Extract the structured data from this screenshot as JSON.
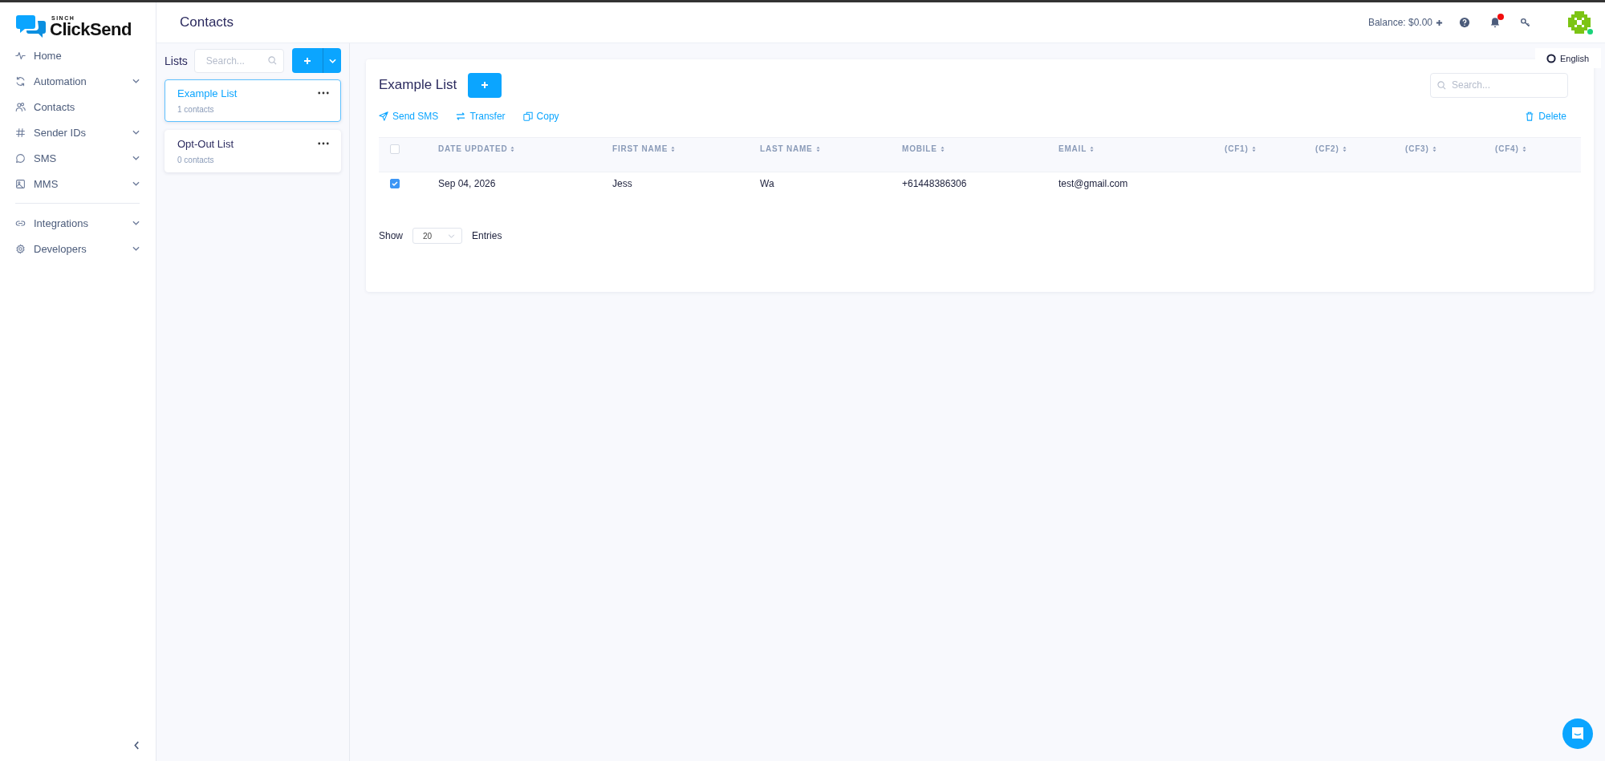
{
  "logo": {
    "brand": "SINCH",
    "name": "ClickSend"
  },
  "sidebar": {
    "groups": [
      [
        {
          "label": "Home",
          "expandable": false
        },
        {
          "label": "Automation",
          "expandable": true
        },
        {
          "label": "Contacts",
          "expandable": false
        },
        {
          "label": "Sender IDs",
          "expandable": true
        },
        {
          "label": "SMS",
          "expandable": true
        },
        {
          "label": "MMS",
          "expandable": true
        }
      ],
      [
        {
          "label": "Integrations",
          "expandable": true
        },
        {
          "label": "Developers",
          "expandable": true
        }
      ]
    ]
  },
  "header": {
    "title": "Contacts",
    "balance": "Balance: $0.00",
    "notifications_unread": true,
    "avatar_online": true
  },
  "language": "English",
  "lists_panel": {
    "title": "Lists",
    "search": {
      "placeholder": "Search..."
    },
    "lists": [
      {
        "name": "Example List",
        "count": "1 contacts",
        "selected": true
      },
      {
        "name": "Opt-Out List",
        "count": "0 contacts",
        "selected": false
      }
    ]
  },
  "main": {
    "title": "Example List",
    "search": {
      "placeholder": "Search..."
    },
    "actions": [
      {
        "label": "Send SMS"
      },
      {
        "label": "Transfer"
      },
      {
        "label": "Copy"
      }
    ],
    "delete": "Delete",
    "table": {
      "header_checked": false,
      "columns": [
        "DATE UPDATED",
        "FIRST NAME",
        "LAST NAME",
        "MOBILE",
        "EMAIL",
        "(CF1)",
        "(CF2)",
        "(CF3)",
        "(CF4)"
      ],
      "rows": [
        {
          "checked": true,
          "cells": [
            "Sep 04, 2026",
            "Jess",
            "Wa",
            "+61448386306",
            "test@gmail.com"
          ]
        }
      ]
    },
    "pagination": {
      "show": "Show",
      "value": "20",
      "entries": "Entries"
    }
  }
}
